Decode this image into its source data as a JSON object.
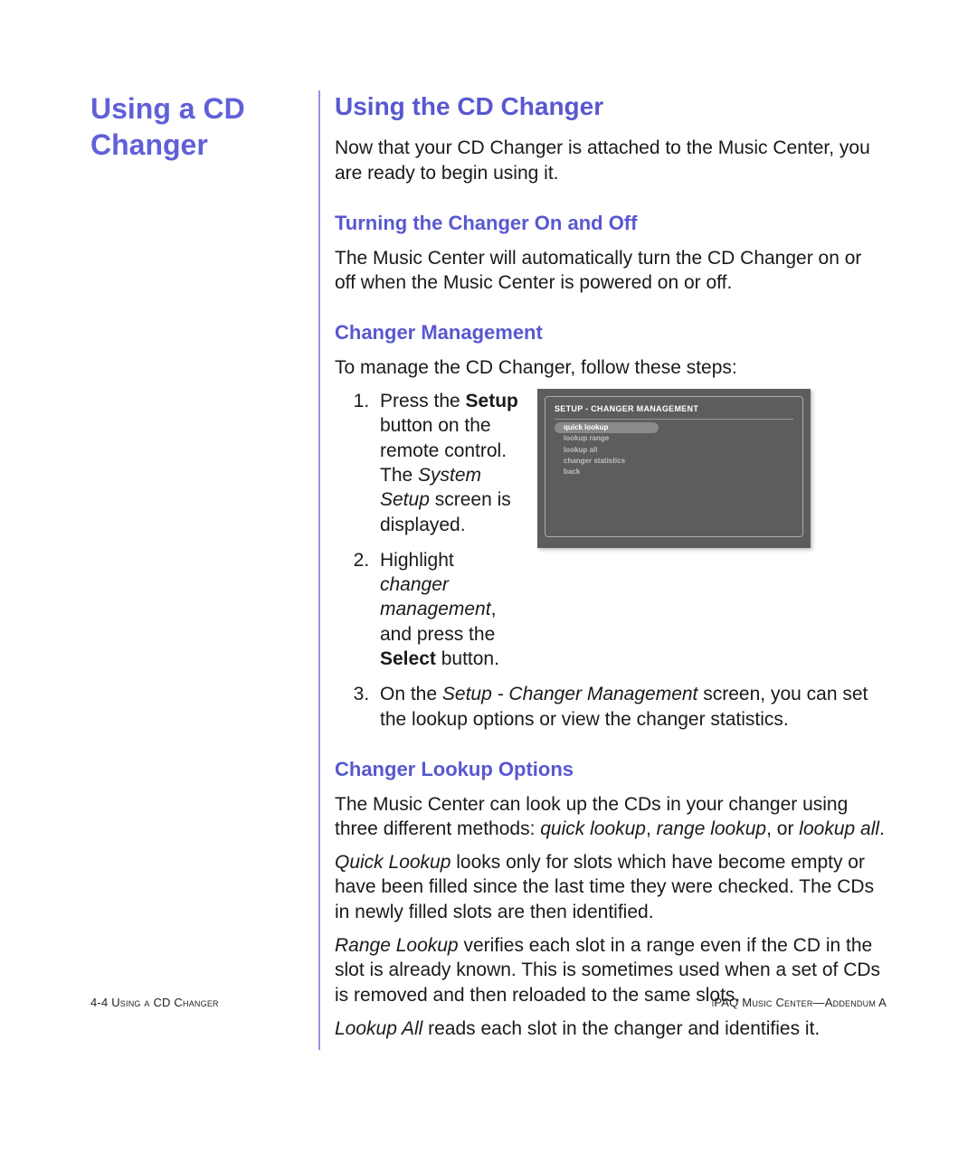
{
  "side": {
    "title_l1": "Using a CD",
    "title_l2": "Changer"
  },
  "main": {
    "h2": "Using the CD Changer",
    "intro": "Now that your CD Changer is attached to the Music Center, you are ready to begin using it.",
    "s1": {
      "h3": "Turning the Changer On and Off",
      "p": "The Music Center will automatically turn the CD Changer on or off when the Music Center is powered on or off."
    },
    "s2": {
      "h3": "Changer Management",
      "lead": "To manage the CD Changer, follow these steps:",
      "step1": {
        "a": "Press the ",
        "b": "Setup",
        "c": " button on the remote control. The ",
        "d": "System Setup",
        "e": " screen is displayed."
      },
      "step2": {
        "a": "Highlight ",
        "b": "changer management",
        "c": ", and press the ",
        "d": "Select",
        "e": " button."
      },
      "step3": {
        "a": "On the ",
        "b": "Setup - Changer Management",
        "c": " screen, you can set the lookup options or view the changer statistics."
      }
    },
    "s3": {
      "h3": "Changer Lookup Options",
      "p1a": "The Music Center can look up the CDs in your changer using three different methods: ",
      "p1b": "quick lookup",
      "p1c": ", ",
      "p1d": "range lookup",
      "p1e": ", or ",
      "p1f": "lookup all",
      "p1g": ".",
      "p2a": "Quick Lookup",
      "p2b": " looks only for slots which have become empty or have been filled since the last time they were checked. The CDs in newly filled slots are then identified.",
      "p3a": "Range Lookup",
      "p3b": " verifies each slot in a range even if the CD in the slot is already known. This is sometimes used when a set of CDs is removed and then reloaded to the same slots.",
      "p4a": "Lookup All",
      "p4b": " reads each slot in the changer and identifies it."
    }
  },
  "shot": {
    "title": "SETUP - CHANGER MANAGEMENT",
    "items": [
      "quick lookup",
      "lookup range",
      "lookup all",
      "changer statistics",
      "back"
    ]
  },
  "footer": {
    "left_num": "4-4 ",
    "left_caps_a": "U",
    "left_rest_a": "sing a ",
    "left_caps_b": "CD C",
    "left_rest_b": "hanger",
    "right_a": "iPAQ M",
    "right_b": "usic ",
    "right_c": "C",
    "right_d": "enter—",
    "right_e": "A",
    "right_f": "ddendum ",
    "right_g": "A"
  }
}
